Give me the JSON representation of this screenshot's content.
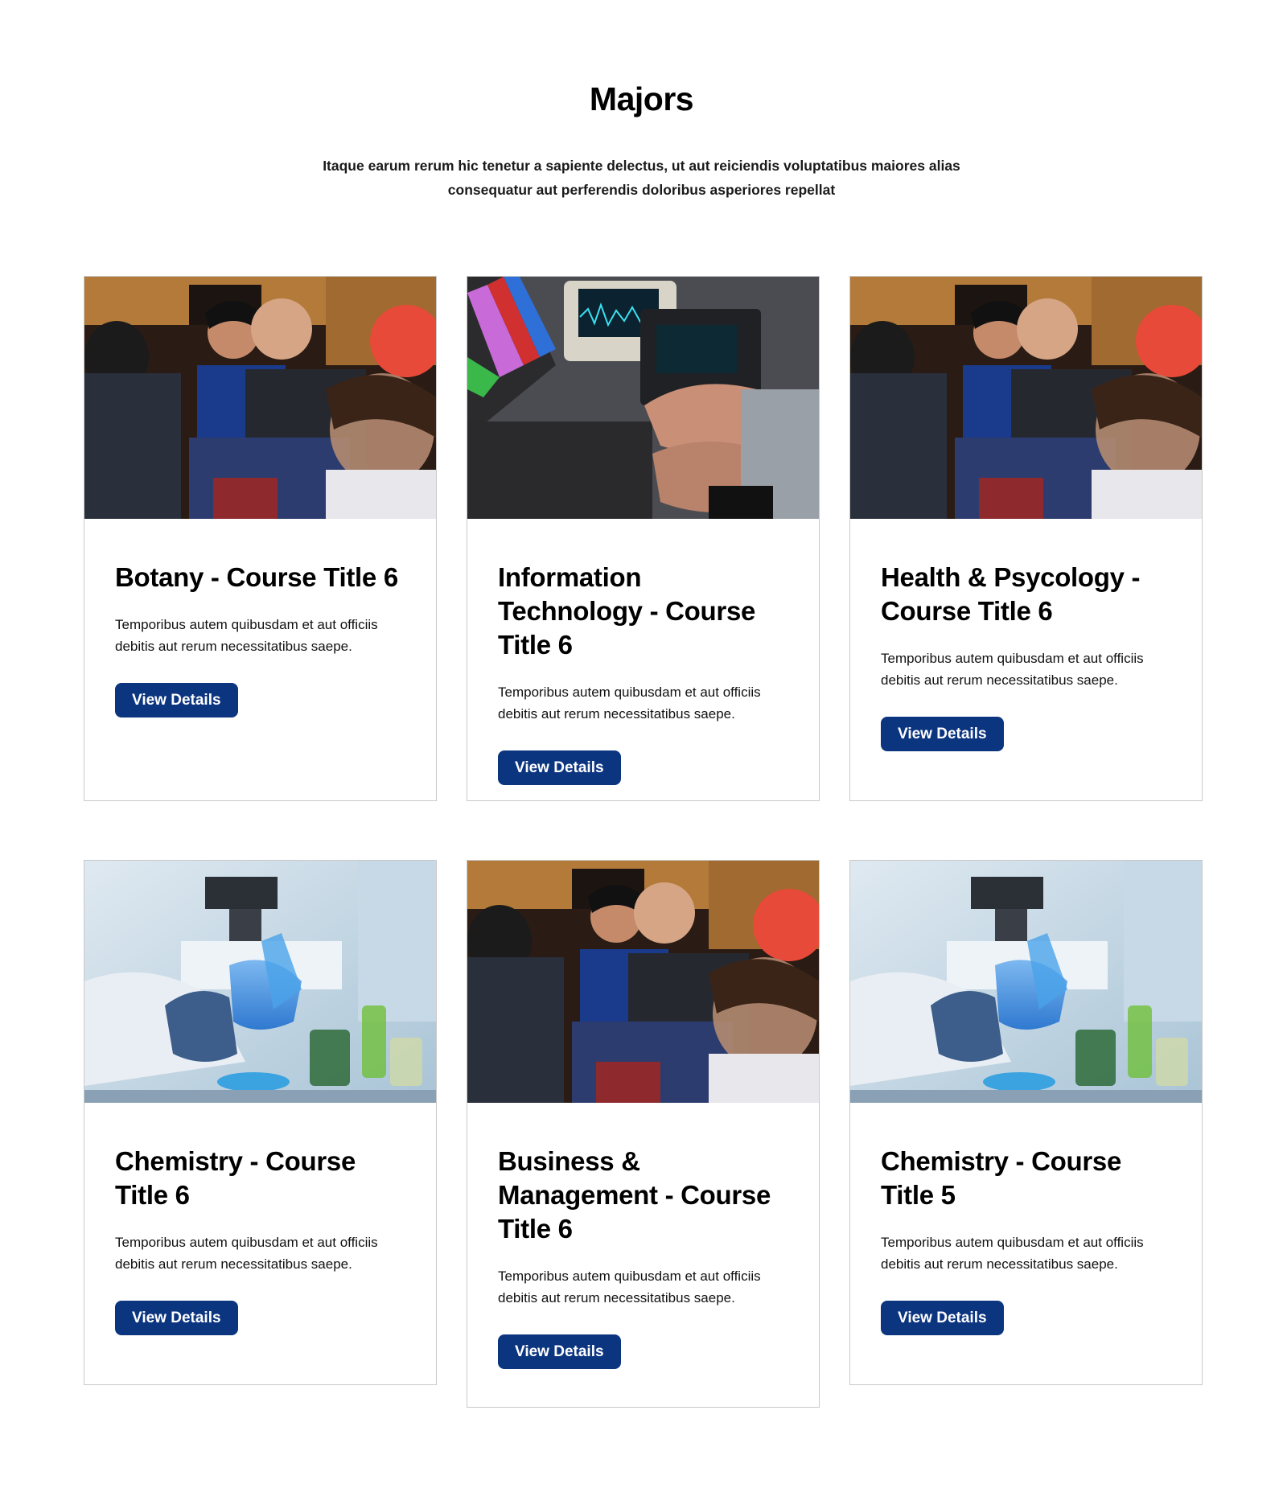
{
  "section": {
    "title": "Majors",
    "subtitle": "Itaque earum rerum hic tenetur a sapiente delectus, ut aut reiciendis voluptatibus maiores alias consequatur aut perferendis doloribus asperiores repellat"
  },
  "colors": {
    "button_bg": "#0c3580",
    "button_text": "#ffffff",
    "card_border": "#c9c9c9"
  },
  "cards": [
    {
      "image": "lecture-audience-photo",
      "title": "Botany - Course Title 6",
      "text": "Temporibus autem quibusdam et aut officiis debitis aut rerum necessitatibus saepe.",
      "button_label": "View Details"
    },
    {
      "image": "electronics-lab-oscilloscope-photo",
      "title": "Information Technology - Course Title 6",
      "text": "Temporibus autem quibusdam et aut officiis debitis aut rerum necessitatibus saepe.",
      "button_label": "View Details"
    },
    {
      "image": "lecture-audience-photo",
      "title": "Health & Psycology - Course Title 6",
      "text": "Temporibus autem quibusdam et aut officiis debitis aut rerum necessitatibus saepe.",
      "button_label": "View Details"
    },
    {
      "image": "chemistry-lab-flask-photo",
      "title": "Chemistry - Course Title 6",
      "text": "Temporibus autem quibusdam et aut officiis debitis aut rerum necessitatibus saepe.",
      "button_label": "View Details"
    },
    {
      "image": "lecture-audience-photo",
      "title": "Business & Management - Course Title 6",
      "text": "Temporibus autem quibusdam et aut officiis debitis aut rerum necessitatibus saepe.",
      "button_label": "View Details"
    },
    {
      "image": "chemistry-lab-flask-photo",
      "title": "Chemistry - Course Title 5",
      "text": "Temporibus autem quibusdam et aut officiis debitis aut rerum necessitatibus saepe.",
      "button_label": "View Details"
    }
  ]
}
